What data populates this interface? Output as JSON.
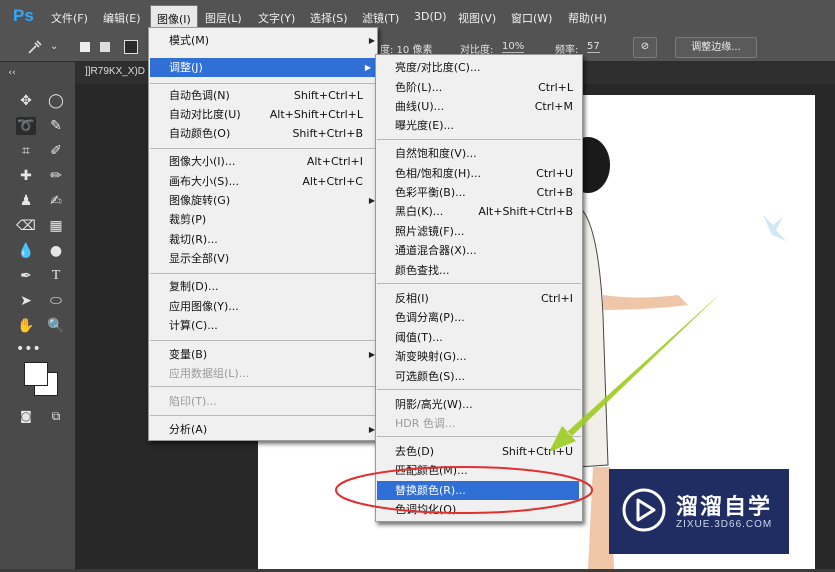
{
  "app": {
    "logo": "Ps"
  },
  "menubar": {
    "items": [
      "文件(F)",
      "编辑(E)",
      "图像(I)",
      "图层(L)",
      "文字(Y)",
      "选择(S)",
      "滤镜(T)",
      "3D(D)",
      "视图(V)",
      "窗口(W)",
      "帮助(H)"
    ],
    "active_index": 2
  },
  "options_bar": {
    "brush_size_label": "度: 10 像素",
    "contrast_label": "对比度:",
    "contrast_value": "10%",
    "frequency_label": "频率:",
    "frequency_value": "57",
    "refine_edge_button": "调整边缘..."
  },
  "document": {
    "tab_title": "]]R79KX_X)D"
  },
  "image_menu": {
    "items": [
      {
        "label": "模式(M)",
        "shortcut": "",
        "submenu": true
      },
      {
        "label": "调整(J)",
        "shortcut": "",
        "submenu": true,
        "highlighted": true
      },
      {
        "label": "自动色调(N)",
        "shortcut": "Shift+Ctrl+L"
      },
      {
        "label": "自动对比度(U)",
        "shortcut": "Alt+Shift+Ctrl+L"
      },
      {
        "label": "自动颜色(O)",
        "shortcut": "Shift+Ctrl+B"
      },
      {
        "label": "图像大小(I)...",
        "shortcut": "Alt+Ctrl+I"
      },
      {
        "label": "画布大小(S)...",
        "shortcut": "Alt+Ctrl+C"
      },
      {
        "label": "图像旋转(G)",
        "shortcut": "",
        "submenu": true
      },
      {
        "label": "裁剪(P)",
        "shortcut": ""
      },
      {
        "label": "裁切(R)...",
        "shortcut": ""
      },
      {
        "label": "显示全部(V)",
        "shortcut": ""
      },
      {
        "label": "复制(D)...",
        "shortcut": ""
      },
      {
        "label": "应用图像(Y)...",
        "shortcut": ""
      },
      {
        "label": "计算(C)...",
        "shortcut": ""
      },
      {
        "label": "变量(B)",
        "shortcut": "",
        "submenu": true
      },
      {
        "label": "应用数据组(L)...",
        "shortcut": "",
        "disabled": true
      },
      {
        "label": "陷印(T)...",
        "shortcut": "",
        "disabled": true
      },
      {
        "label": "分析(A)",
        "shortcut": "",
        "submenu": true
      }
    ]
  },
  "adjust_submenu": {
    "items": [
      {
        "label": "亮度/对比度(C)...",
        "shortcut": ""
      },
      {
        "label": "色阶(L)...",
        "shortcut": "Ctrl+L"
      },
      {
        "label": "曲线(U)...",
        "shortcut": "Ctrl+M"
      },
      {
        "label": "曝光度(E)...",
        "shortcut": ""
      },
      {
        "label": "自然饱和度(V)...",
        "shortcut": ""
      },
      {
        "label": "色相/饱和度(H)...",
        "shortcut": "Ctrl+U"
      },
      {
        "label": "色彩平衡(B)...",
        "shortcut": "Ctrl+B"
      },
      {
        "label": "黑白(K)...",
        "shortcut": "Alt+Shift+Ctrl+B"
      },
      {
        "label": "照片滤镜(F)...",
        "shortcut": ""
      },
      {
        "label": "通道混合器(X)...",
        "shortcut": ""
      },
      {
        "label": "颜色查找...",
        "shortcut": ""
      },
      {
        "label": "反相(I)",
        "shortcut": "Ctrl+I"
      },
      {
        "label": "色调分离(P)...",
        "shortcut": ""
      },
      {
        "label": "阈值(T)...",
        "shortcut": ""
      },
      {
        "label": "渐变映射(G)...",
        "shortcut": ""
      },
      {
        "label": "可选颜色(S)...",
        "shortcut": ""
      },
      {
        "label": "阴影/高光(W)...",
        "shortcut": ""
      },
      {
        "label": "HDR 色调...",
        "shortcut": "",
        "disabled": true
      },
      {
        "label": "去色(D)",
        "shortcut": "Shift+Ctrl+U"
      },
      {
        "label": "匹配颜色(M)...",
        "shortcut": ""
      },
      {
        "label": "替换颜色(R)...",
        "shortcut": "",
        "highlighted": true
      },
      {
        "label": "色调均化(Q)",
        "shortcut": ""
      }
    ]
  },
  "watermark": {
    "title": "溜溜自学",
    "url": "ZIXUE.3D66.COM"
  },
  "colors": {
    "highlight": "#2f6fd6",
    "annotation_circle": "#e03030",
    "annotation_arrow": "#9ccc1e",
    "watermark_bg": "#1f2d63"
  }
}
